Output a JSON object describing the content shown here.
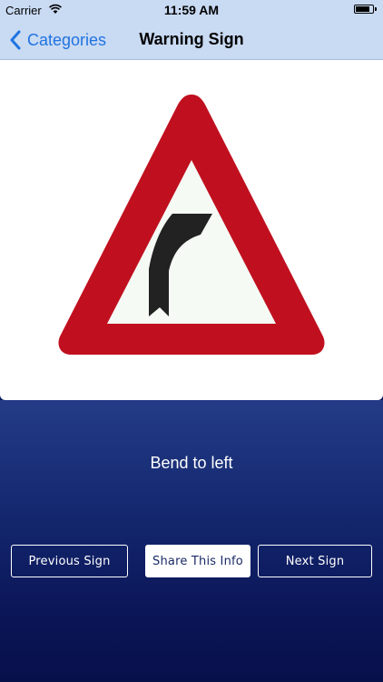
{
  "status_bar": {
    "carrier": "Carrier",
    "time": "11:59 AM",
    "battery_level": 0.85
  },
  "nav": {
    "back_label": "Categories",
    "title": "Warning Sign"
  },
  "sign": {
    "name": "Bend to left",
    "icons": [
      "warning-triangle-icon",
      "curve-arrow-icon"
    ],
    "colors": {
      "border": "#c0101f",
      "inner": "#f5faf5",
      "curve": "#222222"
    }
  },
  "actions": {
    "previous_label": "Previous Sign",
    "share_label": "Share This Info",
    "next_label": "Next Sign"
  },
  "colors": {
    "nav_background": "#c9daf3",
    "accent": "#1f73e0",
    "background_top": "#243b86",
    "background_bottom": "#08104a"
  }
}
